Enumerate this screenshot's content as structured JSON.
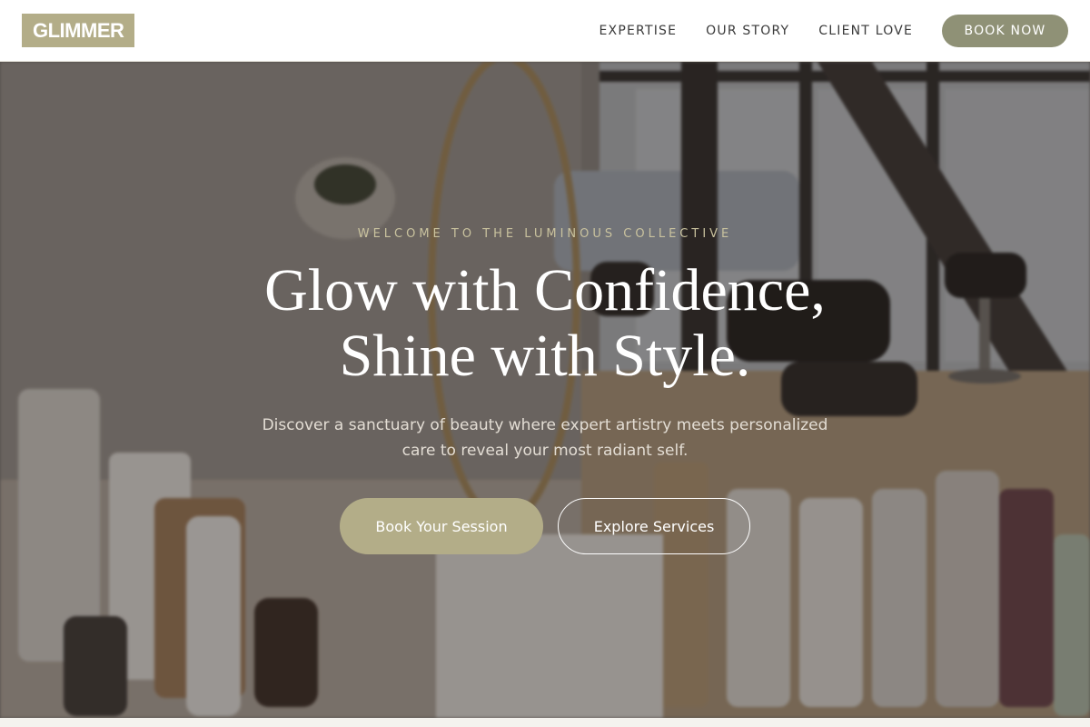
{
  "brand": {
    "logo_text": "GLIMMER",
    "accent": "#b3ad88",
    "cta_color": "#8f9176"
  },
  "nav": {
    "items": [
      {
        "label": "EXPERTISE"
      },
      {
        "label": "OUR STORY"
      },
      {
        "label": "CLIENT LOVE"
      }
    ],
    "cta_label": "BOOK NOW"
  },
  "hero": {
    "eyebrow": "WELCOME TO THE LUMINOUS COLLECTIVE",
    "headline_line1": "Glow with Confidence,",
    "headline_line2": "Shine with Style.",
    "subtext": "Discover a sanctuary of beauty where expert artistry meets personalized care to reveal your most radiant self.",
    "primary_button": "Book Your Session",
    "secondary_button": "Explore Services",
    "background": "blurred salon interior with styling chairs and product bottles"
  }
}
